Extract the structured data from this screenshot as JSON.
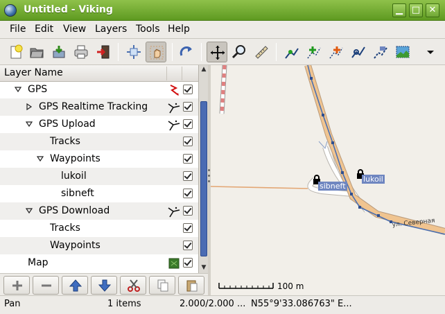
{
  "window": {
    "title": "Untitled - Viking",
    "controls": [
      "minimize-icon",
      "maximize-icon",
      "close-icon"
    ]
  },
  "menu": {
    "file": "File",
    "edit": "Edit",
    "view": "View",
    "layers": "Layers",
    "tools": "Tools",
    "help": "Help"
  },
  "toolbar": {
    "icons": [
      "new-icon",
      "open-icon",
      "save-icon",
      "print-icon",
      "exit-icon",
      "zoom-fit-icon",
      "select-icon",
      "redo-icon",
      "pan-icon",
      "zoom-icon",
      "ruler-icon",
      "edit-trackpoint-icon",
      "create-waypoint-icon",
      "create-track-icon",
      "route-finder-icon",
      "edit-waypoint-icon",
      "georef-map-icon",
      "overflow-chevron-icon"
    ],
    "active": [
      "select-icon",
      "pan-icon"
    ]
  },
  "layers_panel": {
    "column_header": "Layer Name",
    "rows": [
      {
        "label": "GPS",
        "expander": "expanded",
        "icon": "gps-icon",
        "checked": true,
        "indent": 1
      },
      {
        "label": "GPS Realtime Tracking",
        "expander": "collapsed",
        "icon": "trw-layer-icon",
        "checked": true,
        "indent": 2
      },
      {
        "label": "GPS Upload",
        "expander": "expanded",
        "icon": "trw-layer-icon",
        "checked": true,
        "indent": 2
      },
      {
        "label": "Tracks",
        "expander": "none",
        "icon": "",
        "checked": true,
        "indent": 3
      },
      {
        "label": "Waypoints",
        "expander": "expanded",
        "icon": "",
        "checked": true,
        "indent": 3
      },
      {
        "label": "lukoil",
        "expander": "none",
        "icon": "",
        "checked": true,
        "indent": 4
      },
      {
        "label": "sibneft",
        "expander": "none",
        "icon": "",
        "checked": true,
        "indent": 4
      },
      {
        "label": "GPS Download",
        "expander": "expanded",
        "icon": "trw-layer-icon",
        "checked": true,
        "indent": 2
      },
      {
        "label": "Tracks",
        "expander": "none",
        "icon": "",
        "checked": true,
        "indent": 3
      },
      {
        "label": "Waypoints",
        "expander": "none",
        "icon": "",
        "checked": true,
        "indent": 3
      },
      {
        "label": "Map",
        "expander": "none",
        "icon": "map-layer-icon",
        "checked": true,
        "indent": 1
      }
    ],
    "buttons": [
      "add-icon",
      "remove-icon",
      "move-up-icon",
      "move-down-icon",
      "cut-icon",
      "copy-icon",
      "paste-icon"
    ]
  },
  "map": {
    "waypoints": [
      "sibneft",
      "lukoil"
    ],
    "street_label": "ул. Северная",
    "scale_label": "100 m",
    "colors": {
      "road": "#f0c490",
      "track": "#4b6fb0",
      "waypoint_label_bg": "#6f86c0"
    }
  },
  "status": {
    "tool": "Pan",
    "items": "1 items",
    "zoom": "2.000/2.000 ...",
    "position": "N55°9'33.086763\" E..."
  }
}
